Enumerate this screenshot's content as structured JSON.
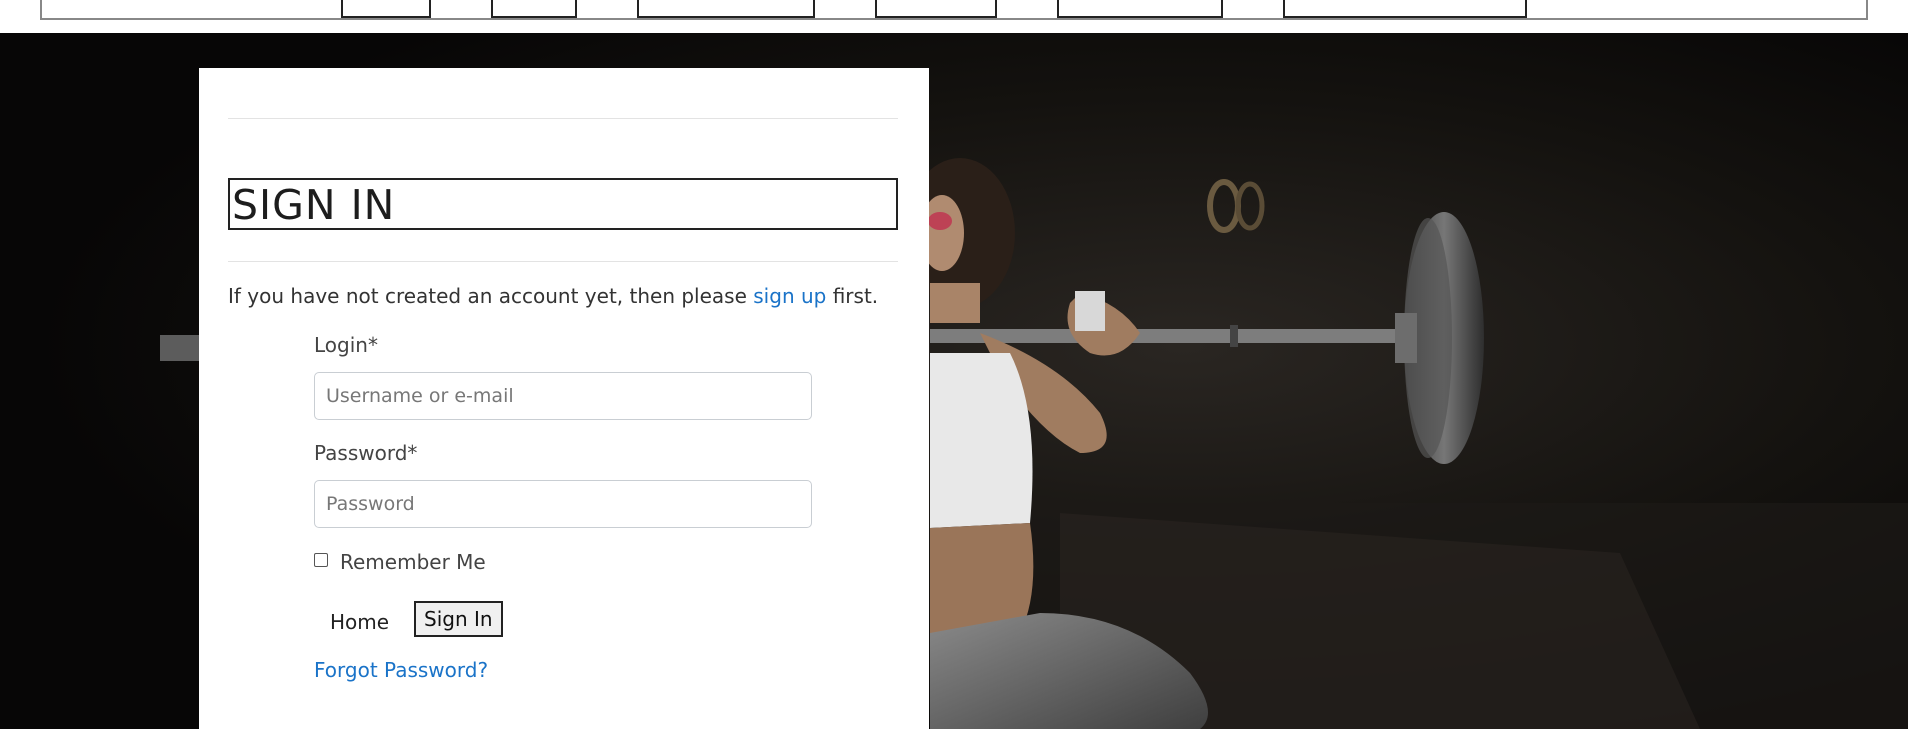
{
  "nav": {
    "items": [
      "",
      "",
      "",
      "",
      "",
      ""
    ]
  },
  "signin": {
    "title": "SIGN IN",
    "intro_before": "If you have not created an account yet, then please ",
    "intro_link": "sign up",
    "intro_after": " first.",
    "login_label": "Login*",
    "login_placeholder": "Username or e-mail",
    "password_label": "Password*",
    "password_placeholder": "Password",
    "remember_label": "Remember Me",
    "home_label": "Home",
    "submit_label": "Sign In",
    "forgot_label": "Forgot Password?"
  },
  "colors": {
    "link": "#1a73c8",
    "hero_bg": "#0b0a09"
  }
}
